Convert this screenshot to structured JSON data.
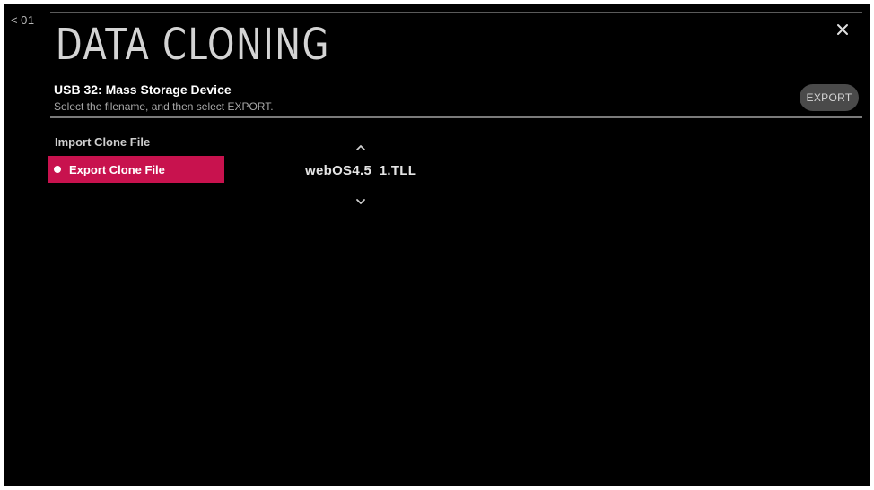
{
  "nav": {
    "back_chevron": "<",
    "page_number": "01"
  },
  "header": {
    "title": "DATA CLONING",
    "device": "USB 32: Mass Storage Device",
    "instruction": "Select the filename, and then select EXPORT.",
    "export_label": "EXPORT",
    "close_icon": "close-icon"
  },
  "menu": {
    "items": [
      {
        "label": "Import Clone File",
        "selected": false
      },
      {
        "label": "Export Clone File",
        "selected": true
      }
    ]
  },
  "file_picker": {
    "filename": "webOS4.5_1.TLL",
    "up_icon": "chevron-up-icon",
    "down_icon": "chevron-down-icon"
  },
  "colors": {
    "background": "#000000",
    "accent": "#c8124e",
    "button_bg": "#4a4a4a",
    "text_primary": "#ffffff",
    "text_secondary": "#a9a9a9"
  }
}
